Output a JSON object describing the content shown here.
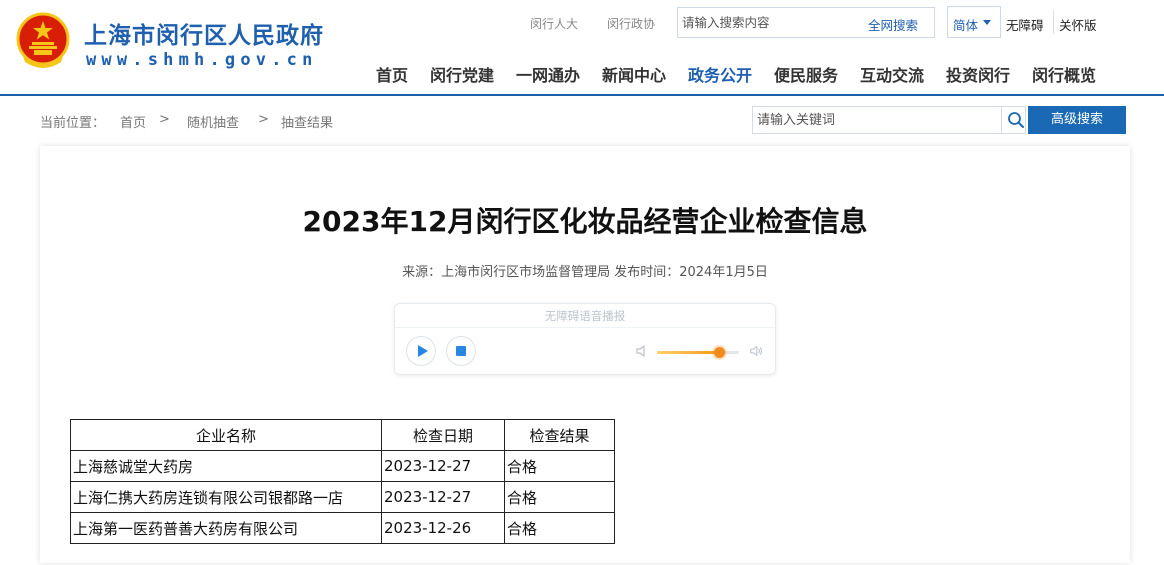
{
  "header": {
    "site_title": "上海市闵行区人民政府",
    "site_url": "www.shmh.gov.cn",
    "top_links": [
      "闵行人大",
      "闵行政协"
    ],
    "search": {
      "placeholder": "请输入搜索内容",
      "button": "全网搜索"
    },
    "lang": "简体",
    "accessibility": "无障碍",
    "care_mode": "关怀版",
    "nav": [
      "首页",
      "闵行党建",
      "一网通办",
      "新闻中心",
      "政务公开",
      "便民服务",
      "互动交流",
      "投资闵行",
      "闵行概览"
    ],
    "nav_active": "政务公开",
    "accent_color": "#1e5fae"
  },
  "breadcrumb": {
    "prefix": "当前位置：",
    "items": [
      "首页",
      "随机抽查",
      "抽查结果"
    ],
    "separator": ">"
  },
  "keyword_search": {
    "placeholder": "请输入关键词",
    "advanced_button": "高级搜索"
  },
  "article": {
    "title": "2023年12月闵行区化妆品经营企业检查信息",
    "meta": "来源：上海市闵行区市场监督管理局  发布时间：2024年1月5日"
  },
  "player": {
    "title": "无障碍语音播报",
    "volume_fraction": 0.75,
    "icons": [
      "play-icon",
      "stop-icon",
      "volume-low-icon",
      "volume-high-icon"
    ]
  },
  "table": {
    "headers": [
      "企业名称",
      "检查日期",
      "检查结果"
    ],
    "rows": [
      [
        "上海慈诚堂大药房",
        "2023-12-27",
        "合格"
      ],
      [
        "上海仁携大药房连锁有限公司银都路一店",
        "2023-12-27",
        "合格"
      ],
      [
        "上海第一医药普善大药房有限公司",
        "2023-12-26",
        "合格"
      ]
    ]
  }
}
